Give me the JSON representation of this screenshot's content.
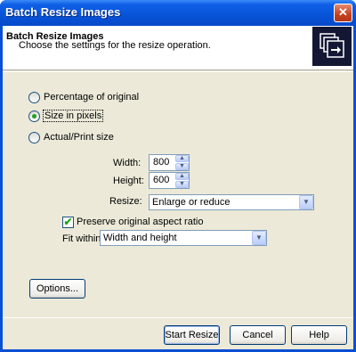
{
  "window": {
    "title": "Batch Resize Images",
    "close_glyph": "✕"
  },
  "header": {
    "title": "Batch Resize Images",
    "subtitle": "Choose the settings for the resize operation.",
    "icon": "batch-resize-icon"
  },
  "mode": {
    "options": [
      {
        "label": "Percentage of original",
        "checked": false
      },
      {
        "label": "Size in pixels",
        "checked": true
      },
      {
        "label": "Actual/Print size",
        "checked": false
      }
    ]
  },
  "size": {
    "width_label": "Width:",
    "width_value": "800",
    "height_label": "Height:",
    "height_value": "600",
    "resize_label": "Resize:",
    "resize_value": "Enlarge or reduce"
  },
  "aspect": {
    "preserve_label": "Preserve original aspect ratio",
    "preserve_checked": true,
    "fit_label": "Fit within:",
    "fit_value": "Width and height"
  },
  "buttons": {
    "options": "Options...",
    "start": "Start Resize",
    "cancel": "Cancel",
    "help": "Help"
  }
}
